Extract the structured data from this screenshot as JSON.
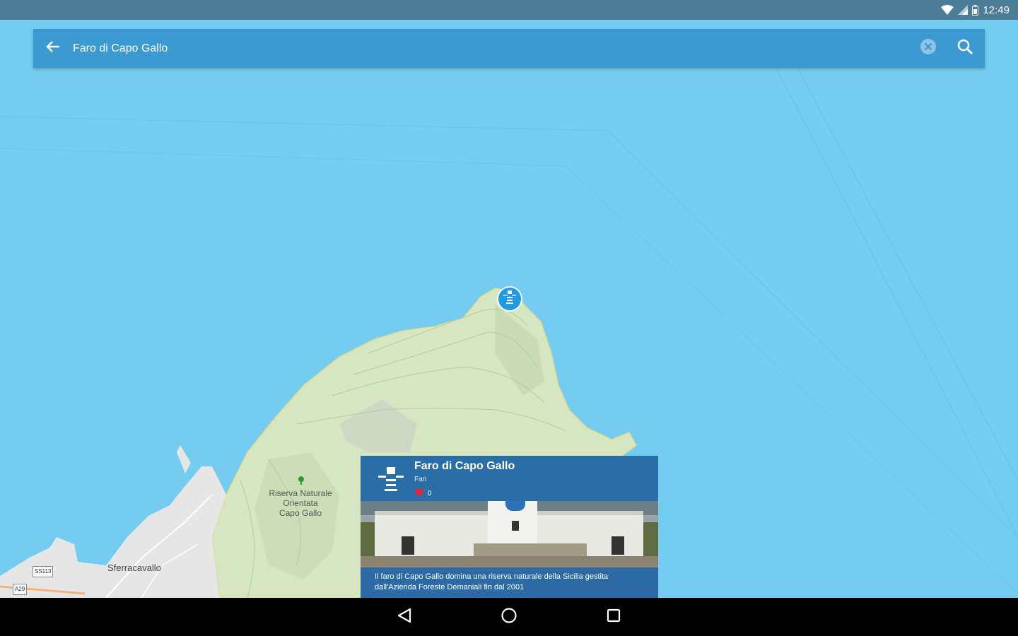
{
  "status_bar": {
    "time": "12:49",
    "icons": [
      "wifi-icon",
      "cellular-signal-icon",
      "battery-icon"
    ]
  },
  "search": {
    "query": "Faro di Capo Gallo",
    "back_icon": "arrow-back-icon",
    "clear_icon": "clear-circle-icon",
    "search_icon": "search-icon"
  },
  "map": {
    "labels": {
      "reserve": [
        "Riserva Naturale",
        "Orientata",
        "Capo Gallo"
      ],
      "town": "Sferracavallo"
    },
    "road_shields": [
      "SS113",
      "A29"
    ],
    "colors": {
      "sea": "#74cdf0",
      "land": "#dde8cf",
      "marker": "#1e9be2"
    }
  },
  "poi_card": {
    "title": "Faro di Capo Gallo",
    "category": "Fari",
    "likes": "0",
    "description": "Il faro di Capo Gallo domina una riserva naturale della Sicilia gestita dall'Azienda Foreste Demaniali fin dal 2001",
    "icon": "lighthouse-icon"
  },
  "nav_bar": {
    "buttons": [
      "back-triangle-icon",
      "home-circle-icon",
      "recents-square-icon"
    ]
  }
}
